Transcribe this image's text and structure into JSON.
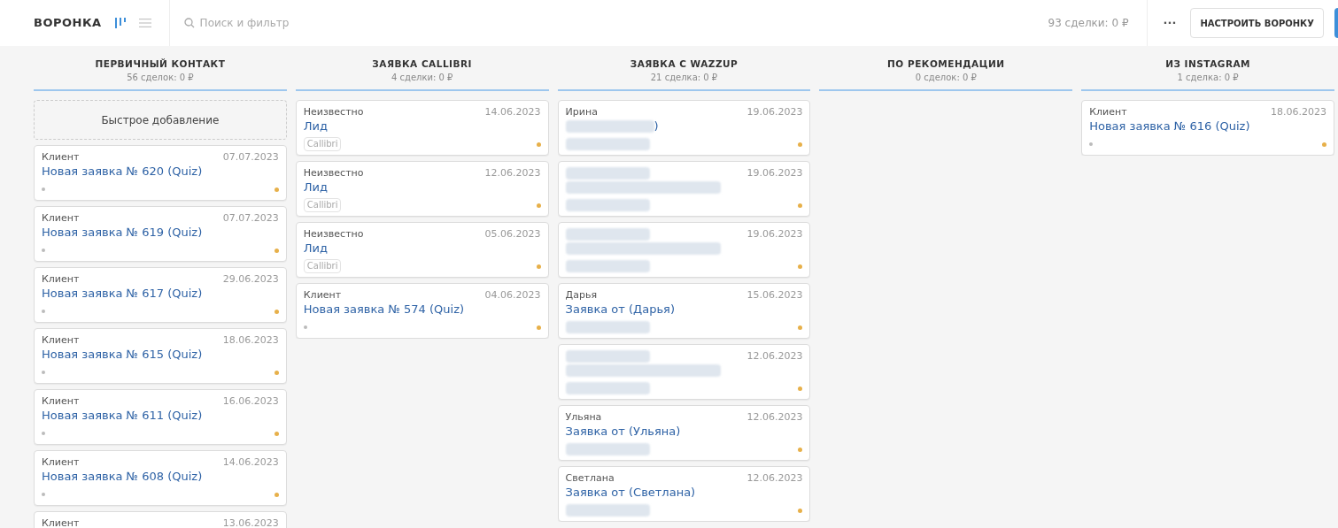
{
  "header": {
    "title": "ВОРОНКА",
    "view_modes": [
      {
        "kind": "kanban",
        "selected": true
      },
      {
        "kind": "list",
        "selected": false
      }
    ],
    "search": {
      "placeholder": "Поиск и фильтр"
    },
    "total": "93 сделки: 0 ₽",
    "more": "···",
    "setup_button": "НАСТРОИТЬ ВОРОНКУ"
  },
  "columns": [
    {
      "title": "ПЕРВИЧНЫЙ КОНТАКТ",
      "summary": "56 сделок: 0 ₽",
      "quick_add": "Быстрое добавление",
      "cards": [
        {
          "contact": "Клиент",
          "date": "07.07.2023",
          "title": "Новая заявка № 620 (Quiz)",
          "has_note": true
        },
        {
          "contact": "Клиент",
          "date": "07.07.2023",
          "title": "Новая заявка № 619 (Quiz)",
          "has_note": true
        },
        {
          "contact": "Клиент",
          "date": "29.06.2023",
          "title": "Новая заявка № 617 (Quiz)",
          "has_note": true
        },
        {
          "contact": "Клиент",
          "date": "18.06.2023",
          "title": "Новая заявка № 615 (Quiz)",
          "has_note": true
        },
        {
          "contact": "Клиент",
          "date": "16.06.2023",
          "title": "Новая заявка № 611 (Quiz)",
          "has_note": true
        },
        {
          "contact": "Клиент",
          "date": "14.06.2023",
          "title": "Новая заявка № 608 (Quiz)",
          "has_note": true
        },
        {
          "contact": "Клиент",
          "date": "13.06.2023"
        }
      ]
    },
    {
      "title": "ЗАЯВКА CALLIBRI",
      "summary": "4 сделки: 0 ₽",
      "cards": [
        {
          "contact": "Неизвестно",
          "date": "14.06.2023",
          "title": "Лид",
          "tag": "Callibri"
        },
        {
          "contact": "Неизвестно",
          "date": "12.06.2023",
          "title": "Лид",
          "tag": "Callibri"
        },
        {
          "contact": "Неизвестно",
          "date": "05.06.2023",
          "title": "Лид",
          "tag": "Callibri"
        },
        {
          "contact": "Клиент",
          "date": "04.06.2023",
          "title": "Новая заявка № 574 (Quiz)",
          "has_note": true
        }
      ]
    },
    {
      "title": "ЗАЯВКА С WAZZUP",
      "summary": "21 сделка: 0 ₽",
      "cards": [
        {
          "contact": "Ирина",
          "date": "19.06.2023",
          "title": ")",
          "title_hidden": true,
          "tag_hidden": true
        },
        {
          "date": "19.06.2023",
          "contact_hidden": true,
          "title_hidden": true,
          "tag_hidden": true
        },
        {
          "date": "19.06.2023",
          "contact_hidden": true,
          "title_hidden": true,
          "tag_hidden": true
        },
        {
          "contact": "Дарья",
          "date": "15.06.2023",
          "title": "Заявка от (Дарья)",
          "tag_hidden": true
        },
        {
          "date": "12.06.2023",
          "contact_hidden": true,
          "title_hidden": true,
          "tag_hidden": true
        },
        {
          "contact": "Ульяна",
          "date": "12.06.2023",
          "title": "Заявка от (Ульяна)",
          "tag_hidden": true
        },
        {
          "contact": "Светлана",
          "date": "12.06.2023",
          "title": "Заявка от (Светлана)",
          "tag_hidden": true
        }
      ]
    },
    {
      "title": "ПО РЕКОМЕНДАЦИИ",
      "summary": "0 сделок: 0 ₽"
    },
    {
      "title": "ИЗ INSTAGRAM",
      "summary": "1 сделка: 0 ₽",
      "cards": [
        {
          "contact": "Клиент",
          "date": "18.06.2023",
          "title": "Новая заявка № 616 (Quiz)",
          "has_note": true
        }
      ]
    }
  ]
}
